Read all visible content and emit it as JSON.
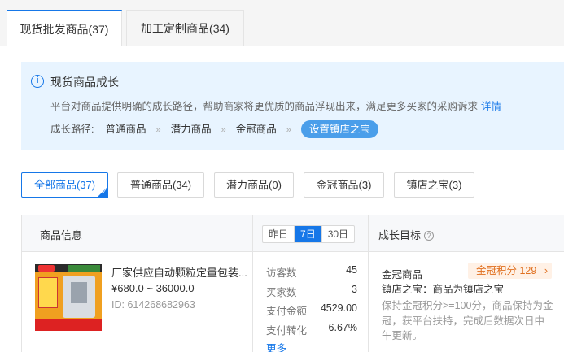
{
  "tabs": [
    {
      "label": "现货批发商品(37)",
      "active": true
    },
    {
      "label": "加工定制商品(34)",
      "active": false
    }
  ],
  "info": {
    "icon": "info-icon",
    "title": "现货商品成长",
    "desc": "平台对商品提供明确的成长路径，帮助商家将更优质的商品浮现出来，满足更多买家的采购诉求",
    "detail_link": "详情",
    "path_label": "成长路径:",
    "steps": [
      "普通商品",
      "潜力商品",
      "金冠商品"
    ],
    "step_separator": "»",
    "action": "设置镇店之宝"
  },
  "filters": [
    {
      "label": "全部商品(37)",
      "active": true
    },
    {
      "label": "普通商品(34)",
      "active": false
    },
    {
      "label": "潜力商品(0)",
      "active": false
    },
    {
      "label": "金冠商品(3)",
      "active": false
    },
    {
      "label": "镇店之宝(3)",
      "active": false
    }
  ],
  "table": {
    "col_product": "商品信息",
    "col_goal": "成长目标",
    "help_icon": "?",
    "periods": [
      "昨日",
      "7日",
      "30日"
    ],
    "active_period": "7日"
  },
  "product": {
    "name": "厂家供应自动颗粒定量包装...",
    "price": "¥680.0 ~ 36000.0",
    "id": "ID: 614268682963",
    "stats": [
      {
        "key": "访客数",
        "value": "45"
      },
      {
        "key": "买家数",
        "value": "3"
      },
      {
        "key": "支付金额",
        "value": "4529.00"
      },
      {
        "key": "支付转化",
        "value": "6.67%"
      }
    ],
    "more": "更多",
    "goal_line1": "金冠商品",
    "goal_line2": "镇店之宝：商品为镇店之宝",
    "score_label": "金冠积分 129",
    "score_chevron": "›",
    "goal_desc": "保持金冠积分>=100分，商品保持为金冠，获平台扶持，完成后数据次日中午更新。"
  },
  "colors": {
    "accent": "#1677e8",
    "info_bg": "#e8f4ff",
    "pill": "#4a9eea",
    "score_text": "#e07020",
    "score_bg": "#fff1e6"
  }
}
